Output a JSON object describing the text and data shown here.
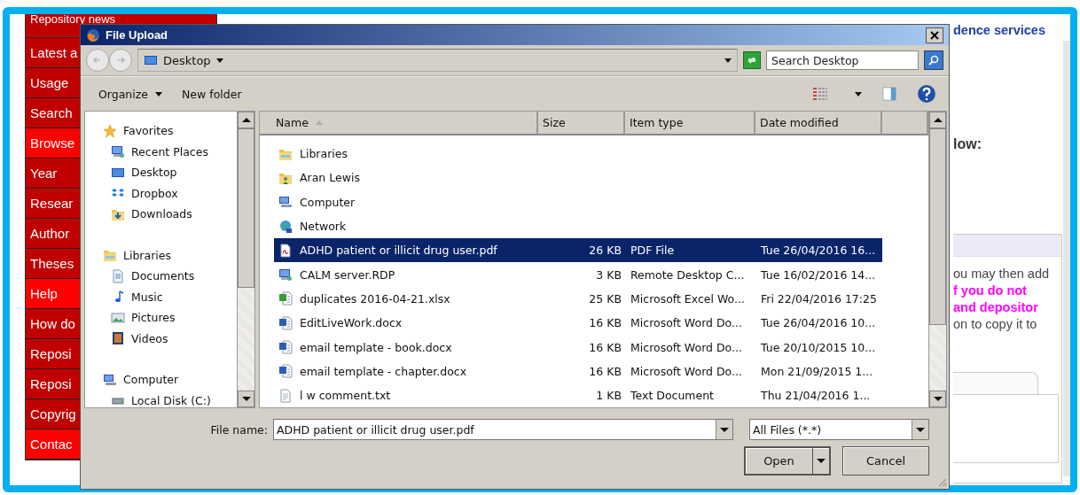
{
  "nav": [
    {
      "label": "Repository news",
      "highlighted": false
    },
    {
      "label": "Latest a",
      "highlighted": false
    },
    {
      "label": "Usage",
      "highlighted": false
    },
    {
      "label": "Search",
      "highlighted": false
    },
    {
      "label": "Browse",
      "highlighted": true
    },
    {
      "label": "Year",
      "highlighted": false
    },
    {
      "label": "Resear",
      "highlighted": false
    },
    {
      "label": "Author",
      "highlighted": false
    },
    {
      "label": "Theses",
      "highlighted": false
    },
    {
      "label": "Help",
      "highlighted": true
    },
    {
      "label": "How do",
      "highlighted": false
    },
    {
      "label": "Reposi",
      "highlighted": false
    },
    {
      "label": "Reposi",
      "highlighted": false
    },
    {
      "label": "Copyrig",
      "highlighted": false
    },
    {
      "label": "Contac",
      "highlighted": true
    }
  ],
  "page": {
    "heading": "dence services",
    "instructions": "low:",
    "panel": {
      "lines": [
        {
          "text": "ou may then add",
          "emphasis": false
        },
        {
          "text": "f you do not",
          "emphasis": true
        },
        {
          "text": "and depositor",
          "emphasis": true
        },
        {
          "text": "on to copy it to",
          "emphasis": false
        }
      ]
    }
  },
  "dialog": {
    "title": "File Upload",
    "location": "Desktop",
    "search": {
      "placeholder": "Search Desktop"
    },
    "toolbar": {
      "organize": "Organize",
      "new_folder": "New folder"
    },
    "tree": [
      {
        "label": "Favorites",
        "kind": "star",
        "children": [
          {
            "label": "Recent Places",
            "kind": "recent"
          },
          {
            "label": "Desktop",
            "kind": "desktop"
          },
          {
            "label": "Dropbox",
            "kind": "dropbox"
          },
          {
            "label": "Downloads",
            "kind": "downloads"
          }
        ]
      },
      {
        "label": "Libraries",
        "kind": "libraries",
        "children": [
          {
            "label": "Documents",
            "kind": "documents"
          },
          {
            "label": "Music",
            "kind": "music"
          },
          {
            "label": "Pictures",
            "kind": "pictures"
          },
          {
            "label": "Videos",
            "kind": "videos"
          }
        ]
      },
      {
        "label": "Computer",
        "kind": "computer",
        "children": [
          {
            "label": "Local Disk (C:)",
            "kind": "disk"
          }
        ]
      }
    ],
    "columns": [
      {
        "label": "Name",
        "sorted": true
      },
      {
        "label": "Size",
        "sorted": false
      },
      {
        "label": "Item type",
        "sorted": false
      },
      {
        "label": "Date modified",
        "sorted": false
      }
    ],
    "rows": [
      {
        "name": "Libraries",
        "kind": "libraries",
        "selected": false
      },
      {
        "name": "Aran Lewis",
        "kind": "user",
        "selected": false
      },
      {
        "name": "Computer",
        "kind": "computer",
        "selected": false
      },
      {
        "name": "Network",
        "kind": "network",
        "selected": false
      },
      {
        "name": "ADHD patient or illicit drug user.pdf",
        "kind": "pdf",
        "size": "26 KB",
        "type": "PDF File",
        "date": "Tue 26/04/2016 16...",
        "selected": true
      },
      {
        "name": "CALM server.RDP",
        "kind": "rdp",
        "size": "3 KB",
        "type": "Remote Desktop C...",
        "date": "Tue 16/02/2016 14...",
        "selected": false
      },
      {
        "name": "duplicates 2016-04-21.xlsx",
        "kind": "xlsx",
        "size": "25 KB",
        "type": "Microsoft Excel Wo...",
        "date": "Fri 22/04/2016 17:25",
        "selected": false
      },
      {
        "name": "EditLiveWork.docx",
        "kind": "docx",
        "size": "16 KB",
        "type": "Microsoft Word Do...",
        "date": "Tue 26/04/2016 10...",
        "selected": false
      },
      {
        "name": "email template - book.docx",
        "kind": "docx",
        "size": "16 KB",
        "type": "Microsoft Word Do...",
        "date": "Tue 20/10/2015 10...",
        "selected": false
      },
      {
        "name": "email template - chapter.docx",
        "kind": "docx",
        "size": "16 KB",
        "type": "Microsoft Word Do...",
        "date": "Mon 21/09/2015 1...",
        "selected": false
      },
      {
        "name": "l w comment.txt",
        "kind": "txt",
        "size": "1 KB",
        "type": "Text Document",
        "date": "Thu 21/04/2016 1...",
        "selected": false
      }
    ],
    "file_name": {
      "label": "File name:",
      "value": "ADHD patient or illicit drug user.pdf"
    },
    "filter": "All Files (*.*)",
    "buttons": {
      "open": "Open",
      "cancel": "Cancel"
    }
  }
}
